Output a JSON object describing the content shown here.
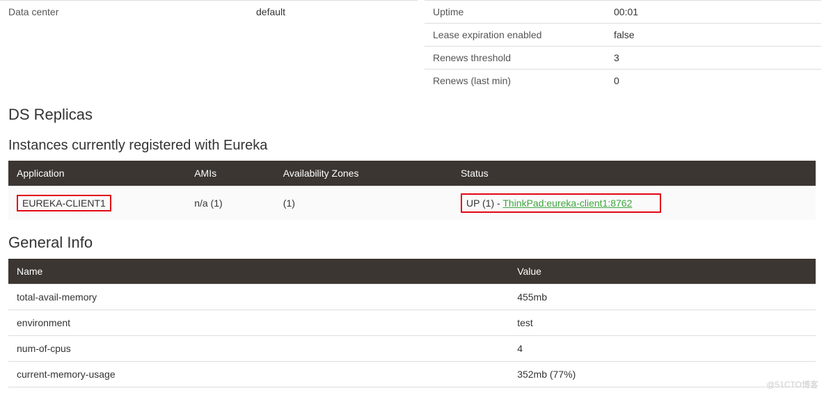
{
  "systemStatus": {
    "left": {
      "dataCenter": {
        "label": "Data center",
        "value": "default"
      }
    },
    "right": {
      "uptime": {
        "label": "Uptime",
        "value": "00:01"
      },
      "leaseExpiration": {
        "label": "Lease expiration enabled",
        "value": "false"
      },
      "renewsThreshold": {
        "label": "Renews threshold",
        "value": "3"
      },
      "renewsLastMin": {
        "label": "Renews (last min)",
        "value": "0"
      }
    }
  },
  "sections": {
    "dsReplicas": "DS Replicas",
    "instances": "Instances currently registered with Eureka",
    "generalInfo": "General Info"
  },
  "instancesTable": {
    "headers": {
      "application": "Application",
      "amis": "AMIs",
      "zones": "Availability Zones",
      "status": "Status"
    },
    "row": {
      "application": "EUREKA-CLIENT1",
      "amis": "n/a (1)",
      "zones": "(1)",
      "statusPrefix": "UP (1) - ",
      "statusLink": "ThinkPad:eureka-client1:8762"
    }
  },
  "generalInfoTable": {
    "headers": {
      "name": "Name",
      "value": "Value"
    },
    "rows": [
      {
        "name": "total-avail-memory",
        "value": "455mb"
      },
      {
        "name": "environment",
        "value": "test"
      },
      {
        "name": "num-of-cpus",
        "value": "4"
      },
      {
        "name": "current-memory-usage",
        "value": "352mb (77%)"
      }
    ]
  },
  "watermark": "@51CTO博客"
}
